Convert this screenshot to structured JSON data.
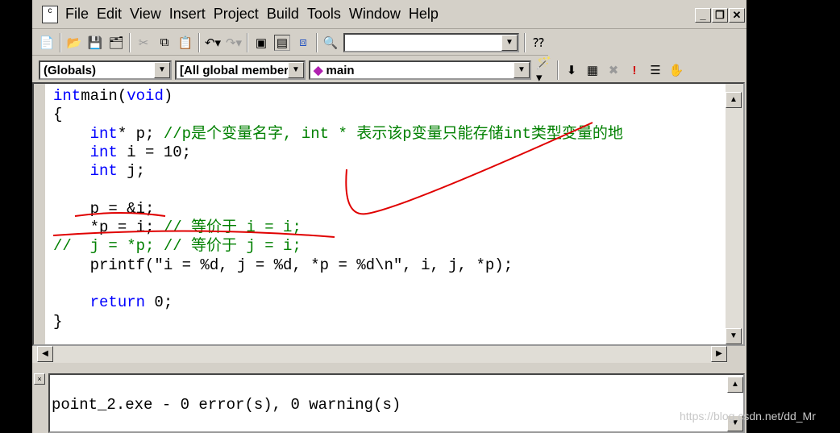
{
  "menu": [
    "File",
    "Edit",
    "View",
    "Insert",
    "Project",
    "Build",
    "Tools",
    "Window",
    "Help"
  ],
  "window_buttons": {
    "minimize": "_",
    "restore": "❐",
    "close": "✕"
  },
  "toolbar": {
    "find_combo": ""
  },
  "wizardbar": {
    "class": "(Globals)",
    "members": "[All global member",
    "function": "main"
  },
  "code": [
    {
      "t": [
        [
          "kw",
          "int"
        ],
        [
          "",
          "main("
        ],
        [
          "kw",
          "void"
        ],
        [
          "",
          ")"
        ]
      ]
    },
    {
      "t": [
        [
          "",
          "{"
        ]
      ]
    },
    {
      "t": [
        [
          "",
          "    "
        ],
        [
          "kw",
          "int"
        ],
        [
          "",
          "* p; "
        ],
        [
          "cm",
          "//p是个变量名字, int * 表示该p变量只能存储int类型变量的地"
        ]
      ]
    },
    {
      "t": [
        [
          "",
          "    "
        ],
        [
          "kw",
          "int"
        ],
        [
          "",
          " i = 10;"
        ]
      ]
    },
    {
      "t": [
        [
          "",
          "    "
        ],
        [
          "kw",
          "int"
        ],
        [
          "",
          " j;"
        ]
      ]
    },
    {
      "t": [
        [
          "",
          ""
        ]
      ]
    },
    {
      "t": [
        [
          "",
          "    p = &i;   "
        ]
      ]
    },
    {
      "t": [
        [
          "",
          "    *p = i; "
        ],
        [
          "cm",
          "// 等价于 i = i;"
        ]
      ]
    },
    {
      "t": [
        [
          "cm",
          "//  j = *p; // 等价于 j = i;"
        ]
      ]
    },
    {
      "t": [
        [
          "",
          "    printf(\"i = %d, j = %d, *p = %d\\n\", i, j, *p);"
        ]
      ]
    },
    {
      "t": [
        [
          "",
          ""
        ]
      ]
    },
    {
      "t": [
        [
          "",
          "    "
        ],
        [
          "kw",
          "return"
        ],
        [
          "",
          " 0;"
        ]
      ]
    },
    {
      "t": [
        [
          "",
          "}"
        ]
      ]
    }
  ],
  "output": {
    "text": "point_2.exe - 0 error(s), 0 warning(s)"
  },
  "watermark": "https://blog.csdn.net/dd_Mr",
  "colors": {
    "keyword": "#0000ff",
    "comment": "#008000",
    "annotation": "#e00000"
  }
}
